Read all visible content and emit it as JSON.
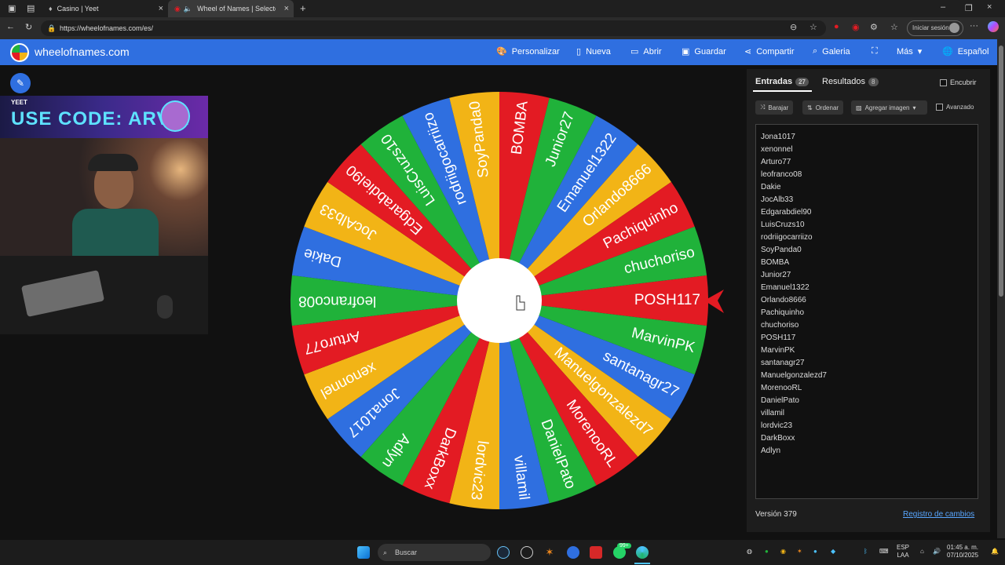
{
  "browser": {
    "tabs": [
      {
        "title": "Casino | Yeet"
      },
      {
        "title": "Wheel of Names | Selector d"
      }
    ],
    "url": "https://wheelofnames.com/es/",
    "signin_label": "Iniciar sesión"
  },
  "navbar": {
    "brand": "wheelofnames.com",
    "items": [
      {
        "label": "Personalizar",
        "icon": "palette-icon"
      },
      {
        "label": "Nueva",
        "icon": "file-icon"
      },
      {
        "label": "Abrir",
        "icon": "folder-icon"
      },
      {
        "label": "Guardar",
        "icon": "save-icon"
      },
      {
        "label": "Compartir",
        "icon": "share-icon"
      },
      {
        "label": "Galeria",
        "icon": "search-icon"
      },
      {
        "label": "",
        "icon": "fullscreen-icon"
      },
      {
        "label": "Más",
        "icon": "chevron-down-icon"
      },
      {
        "label": "Español",
        "icon": "globe-icon"
      }
    ]
  },
  "overlay": {
    "brand": "YEET",
    "promo": "USE CODE: ARVIX"
  },
  "panel": {
    "tab_entries_label": "Entradas",
    "tab_entries_count": "27",
    "tab_results_label": "Resultados",
    "tab_results_count": "8",
    "hide_label": "Encubrir",
    "shuffle_label": "Barajar",
    "sort_label": "Ordenar",
    "add_image_label": "Agregar imagen",
    "advanced_label": "Avanzado",
    "version": "Versión 379",
    "changelog": "Registro de cambios"
  },
  "entries": [
    "Jona1017",
    "xenonnel",
    "Arturo77",
    "leofranco08",
    "Dakie",
    "JocAlb33",
    "Edgarabdiel90",
    "LuisCruzs10",
    "rodriigocarriizo",
    "SoyPanda0",
    "BOMBA",
    "Junior27",
    "Emanuel1322",
    "Orlando8666",
    "Pachiquinho",
    "chuchoriso",
    "POSH117",
    "MarvinPK",
    "santanagr27",
    "Manuelgonzalezd7",
    "MorenooRL",
    "DanielPato",
    "villamil",
    "lordvic23",
    "DarkBoxx",
    "Adlyn"
  ],
  "wheel": {
    "colors": [
      "#2f6fe0",
      "#f2b416",
      "#e31b23",
      "#20b23a"
    ],
    "start_index": 16,
    "start_color": 2
  },
  "taskbar": {
    "search_placeholder": "Buscar",
    "lang": "ESP",
    "lang_sub": "LAA",
    "time": "01:45 a. m.",
    "date": "07/10/2025",
    "notif_count": "99+"
  }
}
